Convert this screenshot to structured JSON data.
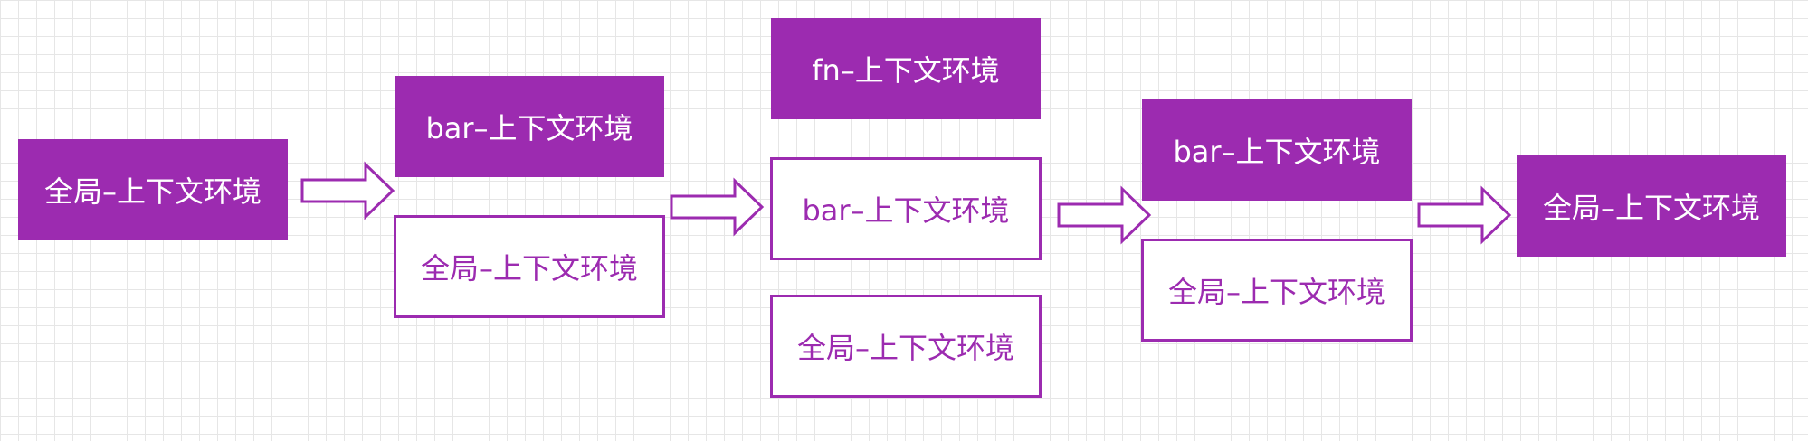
{
  "colors": {
    "accent": "#9c2bb0",
    "background": "#ffffff",
    "grid": "#e6e6e6"
  },
  "stages": [
    {
      "frames": [
        {
          "label": "全局–上下文环境",
          "style": "filled"
        }
      ]
    },
    {
      "frames": [
        {
          "label": "bar–上下文环境",
          "style": "filled"
        },
        {
          "label": "全局–上下文环境",
          "style": "outline"
        }
      ]
    },
    {
      "frames": [
        {
          "label": "fn–上下文环境",
          "style": "filled"
        },
        {
          "label": "bar–上下文环境",
          "style": "outline"
        },
        {
          "label": "全局–上下文环境",
          "style": "outline"
        }
      ]
    },
    {
      "frames": [
        {
          "label": "bar–上下文环境",
          "style": "filled"
        },
        {
          "label": "全局–上下文环境",
          "style": "outline"
        }
      ]
    },
    {
      "frames": [
        {
          "label": "全局–上下文环境",
          "style": "filled"
        }
      ]
    }
  ],
  "arrows": [
    {
      "icon": "right-arrow-icon"
    },
    {
      "icon": "right-arrow-icon"
    },
    {
      "icon": "right-arrow-icon"
    },
    {
      "icon": "right-arrow-icon"
    }
  ]
}
